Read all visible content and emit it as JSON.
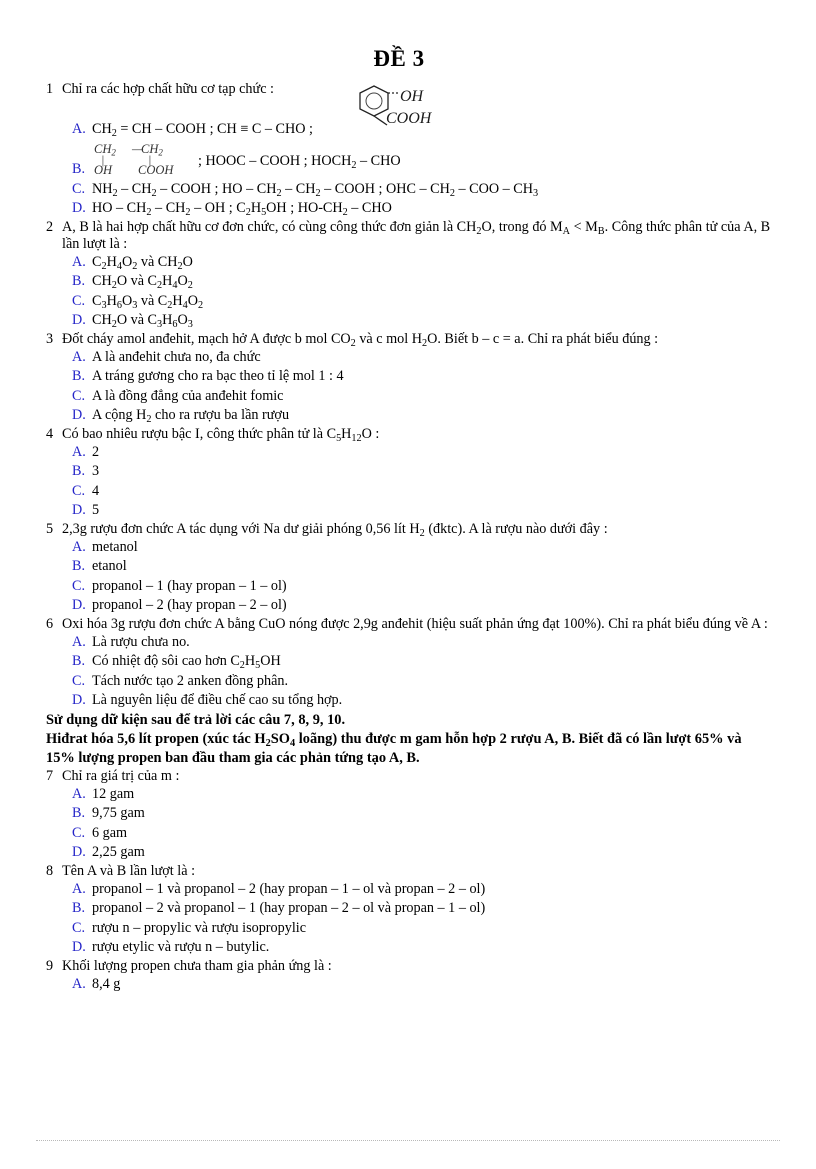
{
  "document": {
    "title": "ĐỀ 3"
  },
  "questions": [
    {
      "number": "1",
      "text": "Chỉ ra các hợp chất hữu cơ tạp chức :",
      "figure": {
        "name": "benzene-ring-structure",
        "substituent_top": "OH",
        "substituent_bottom": "COOH"
      },
      "options": [
        {
          "letter": "A.",
          "text": "CH2 = CH – COOH ; CH ≡ C – CHO ;"
        },
        {
          "letter": "B.",
          "inline_structure": {
            "top_left": "CH2",
            "top_right": "CH2",
            "bond": "–",
            "bottom_left": "OH",
            "bottom_right": "COOH"
          },
          "text": "; HOOC – COOH ; HOCH2 – CHO"
        },
        {
          "letter": "C.",
          "text": "NH2 – CH2 – COOH ; HO – CH2 – CH2 – COOH ; OHC – CH2 – COO – CH3"
        },
        {
          "letter": "D.",
          "text": "HO – CH2 – CH2 – OH ; C2H5OH ; HO-CH2 – CHO"
        }
      ]
    },
    {
      "number": "2",
      "text": "A, B là hai hợp chất hữu cơ đơn chức, có cùng công thức đơn giản là CH2O, trong đó MA < MB. Công thức phân tử của A, B lần lượt là :",
      "options": [
        {
          "letter": "A.",
          "text": "C2H4O2 và CH2O"
        },
        {
          "letter": "B.",
          "text": "CH2O và C2H4O2"
        },
        {
          "letter": "C.",
          "text": "C3H6O3 và C2H4O2"
        },
        {
          "letter": "D.",
          "text": "CH2O và C3H6O3"
        }
      ]
    },
    {
      "number": "3",
      "text": "Đốt cháy amol anđehit, mạch hở A được b mol CO2 và c mol H2O. Biết b – c = a. Chỉ ra phát biểu đúng :",
      "options": [
        {
          "letter": "A.",
          "text": "A là anđehit chưa no, đa chức"
        },
        {
          "letter": "B.",
          "text": "A tráng gương cho ra bạc theo tỉ lệ mol 1 : 4"
        },
        {
          "letter": "C.",
          "text": "A là đồng đẳng của anđehit fomic"
        },
        {
          "letter": "D.",
          "text": "A cộng H2 cho ra rượu ba lần rượu"
        }
      ]
    },
    {
      "number": "4",
      "text": "Có bao nhiêu rượu bậc I, công thức phân tử là C5H12O :",
      "options": [
        {
          "letter": "A.",
          "text": "2"
        },
        {
          "letter": "B.",
          "text": "3"
        },
        {
          "letter": "C.",
          "text": "4"
        },
        {
          "letter": "D.",
          "text": "5"
        }
      ]
    },
    {
      "number": "5",
      "text": "2,3g rượu đơn chức A tác dụng với Na dư giải phóng 0,56 lít H2 (đktc). A là rượu nào dưới đây :",
      "options": [
        {
          "letter": "A.",
          "text": "metanol"
        },
        {
          "letter": "B.",
          "text": "etanol"
        },
        {
          "letter": "C.",
          "text": "propanol – 1 (hay propan – 1 – ol)"
        },
        {
          "letter": "D.",
          "text": "propanol – 2 (hay propan – 2 – ol)"
        }
      ]
    },
    {
      "number": "6",
      "text": "Oxi hóa 3g rượu đơn chức A bằng CuO nóng được 2,9g anđehit (hiệu suất phản ứng đạt 100%). Chỉ ra phát biểu đúng về A :",
      "options": [
        {
          "letter": "A.",
          "text": "Là rượu chưa no."
        },
        {
          "letter": "B.",
          "text": "Có nhiệt độ sôi cao hơn C2H5OH"
        },
        {
          "letter": "C.",
          "text": "Tách nước tạo 2 anken đồng phân."
        },
        {
          "letter": "D.",
          "text": "Là nguyên liệu để điều chế cao su tổng hợp."
        }
      ]
    },
    {
      "number": "7",
      "text": "Chỉ ra giá trị của m :",
      "options": [
        {
          "letter": "A.",
          "text": "12 gam"
        },
        {
          "letter": "B.",
          "text": "9,75 gam"
        },
        {
          "letter": "C.",
          "text": "6 gam"
        },
        {
          "letter": "D.",
          "text": "2,25 gam"
        }
      ]
    },
    {
      "number": "8",
      "text": "Tên A và B lần lượt là :",
      "options": [
        {
          "letter": "A.",
          "text": "propanol – 1 và propanol – 2 (hay propan – 1 – ol và propan – 2 – ol)"
        },
        {
          "letter": "B.",
          "text": "propanol – 2 và propanol – 1 (hay propan – 2 – ol và propan – 1 – ol)"
        },
        {
          "letter": "C.",
          "text": "rượu n – propylic và rượu isopropylic"
        },
        {
          "letter": "D.",
          "text": "rượu etylic và rượu n – butylic."
        }
      ]
    },
    {
      "number": "9",
      "text": "Khối lượng propen chưa tham gia phản ứng là :",
      "options": [
        {
          "letter": "A.",
          "text": "8,4 g"
        }
      ]
    }
  ],
  "instruction_block": {
    "line1": "Sử dụng dữ kiện sau để trả lời các câu 7, 8, 9, 10.",
    "line2": "Hiđrat hóa 5,6 lít propen (xúc tác H2SO4 loãng) thu được m gam hỗn hợp 2 rượu A, B. Biết đã có lần lượt 65% và 15% lượng propen ban đầu tham gia các phản tứng tạo A, B."
  },
  "colors": {
    "option_letter": "#2424c8",
    "text": "#000000",
    "background": "#ffffff"
  }
}
